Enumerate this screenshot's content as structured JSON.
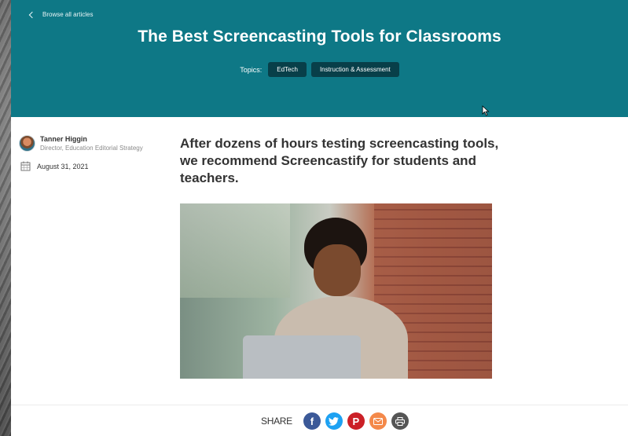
{
  "header": {
    "breadcrumb": "Browse all articles",
    "title": "The Best Screencasting Tools for Classrooms",
    "topics_label": "Topics:",
    "topics": [
      "EdTech",
      "Instruction & Assessment"
    ]
  },
  "author": {
    "name": "Tanner Higgin",
    "role": "Director, Education Editorial Strategy",
    "date": "August 31, 2021"
  },
  "article": {
    "lede": "After dozens of hours testing screencasting tools, we recommend Screencastify for students and teachers."
  },
  "share": {
    "label": "SHARE",
    "buttons": [
      "facebook-icon",
      "twitter-icon",
      "pinterest-icon",
      "email-icon",
      "print-icon"
    ]
  },
  "colors": {
    "hero": "#0e7886",
    "pill": "#083f49",
    "facebook": "#3b5998",
    "twitter": "#1da1f2",
    "pinterest": "#cb2027",
    "email": "#f4894a",
    "print": "#555555"
  }
}
